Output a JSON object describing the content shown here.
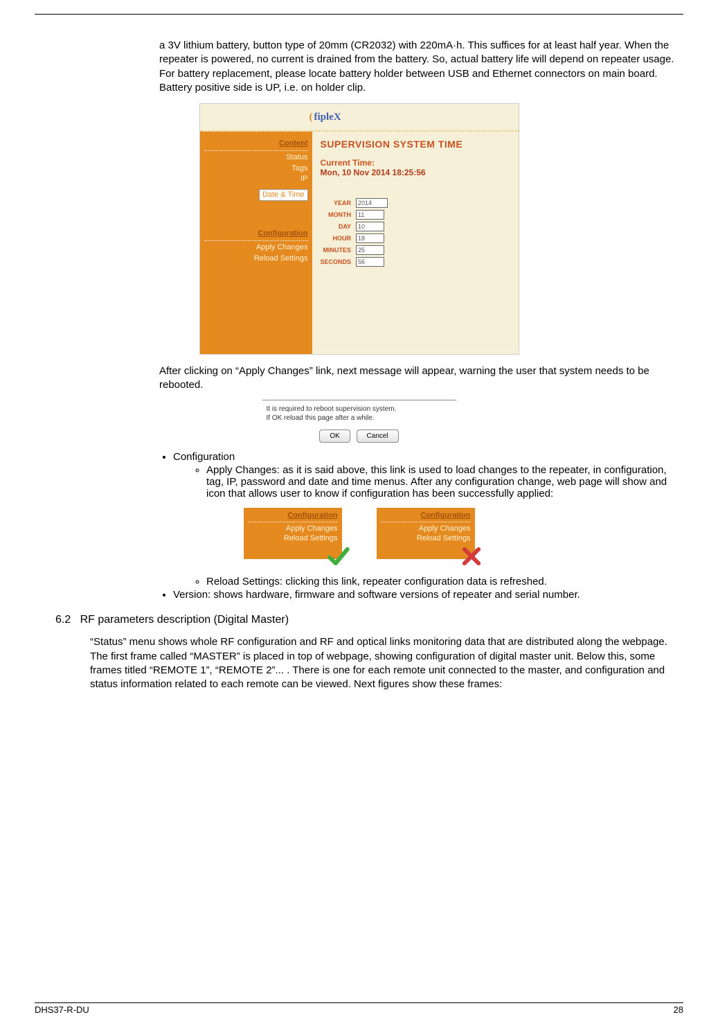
{
  "para1": "a 3V lithium battery, button type of 20mm (CR2032) with 220mA·h. This suffices for at least half year. When the repeater is powered, no current is drained from the battery. So, actual battery life will depend on repeater usage. For battery replacement, please locate battery holder between USB and Ethernet connectors on main board. Battery positive side is UP, i.e. on holder clip.",
  "fiplex": {
    "logo_text": "fipleX",
    "sidebar": {
      "content_head": "Content",
      "items": [
        "Status",
        "Tags",
        "IP"
      ],
      "selected": "Date & Time",
      "config_head": "Configuration",
      "config_items": [
        "Apply Changes",
        "Reload Settings"
      ]
    },
    "content": {
      "title": "SUPERVISION SYSTEM TIME",
      "ct_label": "Current Time:",
      "ct_value": "Mon, 10 Nov 2014 18:25:56",
      "fields": {
        "year": {
          "label": "YEAR",
          "value": "2014"
        },
        "month": {
          "label": "MONTH",
          "value": "11"
        },
        "day": {
          "label": "DAY",
          "value": "10"
        },
        "hour": {
          "label": "HOUR",
          "value": "18"
        },
        "minutes": {
          "label": "MINUTES",
          "value": "25"
        },
        "seconds": {
          "label": "SECONDS",
          "value": "56"
        }
      }
    }
  },
  "para2": "After clicking on “Apply Changes” link, next message will appear, warning the user that system needs to be rebooted.",
  "dialog": {
    "line1": "It is required to reboot supervision system.",
    "line2": "If OK reload this page after a while.",
    "ok": "OK",
    "cancel": "Cancel"
  },
  "bullet_configuration": "Configuration",
  "sub_apply": "Apply Changes: as it is said above, this link is used to load changes to the repeater, in configuration, tag, IP, password and date and time menus. After any configuration change, web page will show and icon that allows user to know if configuration has been successfully applied:",
  "conf_snip": {
    "head": "Configuration",
    "i1": "Apply Changes",
    "i2": "Reload Settings"
  },
  "sub_reload": "Reload Settings: clicking this link, repeater configuration data is refreshed.",
  "bullet_version": "Version: shows hardware, firmware and software versions of repeater and serial number.",
  "section_num": "6.2",
  "section_title": "RF parameters description (Digital Master)",
  "section_p1": "“Status” menu shows whole RF configuration and RF and optical links monitoring data that are distributed along the webpage.",
  "section_p2": "The first frame called “MASTER” is placed in top of webpage, showing configuration of digital master unit. Below this, some frames titled “REMOTE 1”, “REMOTE 2”...  . There is one for each remote unit connected to the master, and configuration and status information related to each remote can be viewed. Next figures show these frames:",
  "footer": {
    "left": "DHS37-R-DU",
    "right": "28"
  }
}
